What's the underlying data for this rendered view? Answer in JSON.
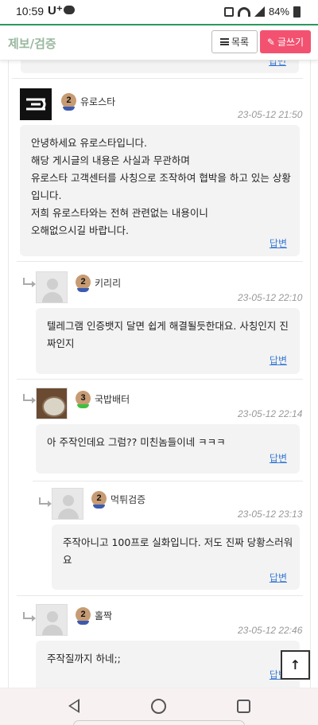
{
  "status_bar": {
    "time": "10:59",
    "carrier": "U⁺",
    "battery": "84%"
  },
  "header": {
    "title": "제보/검증",
    "list_label": "목록",
    "write_label": "글쓰기"
  },
  "top_reply_label": "답변",
  "comments": [
    {
      "level": "2",
      "nickname": "유로스타",
      "date": "23-05-12 21:50",
      "text": "안녕하세요 유로스타입니다.\n해당 게시글의 내용은 사실과 무관하며\n유로스타 고객센터를 사칭으로 조작하여 협박을 하고 있는 상황입니다.\n저희 유로스타와는 전혀 관련없는 내용이니\n오해없으시길 바랍니다.",
      "reply": "답변"
    },
    {
      "level": "2",
      "nickname": "키리리",
      "date": "23-05-12 22:10",
      "text": "텔레그램 인증뱃지 달면 쉽게 해결될듯한대요. 사칭인지 진짜인지",
      "reply": "답변"
    },
    {
      "level": "3",
      "nickname": "국밥배터",
      "date": "23-05-12 22:14",
      "text": "아 주작인데요 그럼?? 미친놈들이네 ㅋㅋㅋ",
      "reply": "답변"
    },
    {
      "level": "2",
      "nickname": "먹튀검증",
      "date": "23-05-12 23:13",
      "text": "주작아니고 100프로 실화입니다. 저도 진짜 당황스러워요",
      "reply": "답변"
    },
    {
      "level": "2",
      "nickname": "홀짝",
      "date": "23-05-12 22:46",
      "text": "주작질까지 하네;;",
      "reply": "답변"
    }
  ],
  "icons": {
    "back": "back-triangle-icon",
    "home": "home-circle-icon",
    "recent": "recent-square-icon",
    "scroll_top": "arrow-up-icon",
    "list": "list-icon",
    "write": "pencil-icon",
    "reply_indent": "reply-arrow-icon"
  },
  "colors": {
    "accent_green": "#2a9a60",
    "write_button": "#f25270",
    "link": "#3a7bd5"
  }
}
